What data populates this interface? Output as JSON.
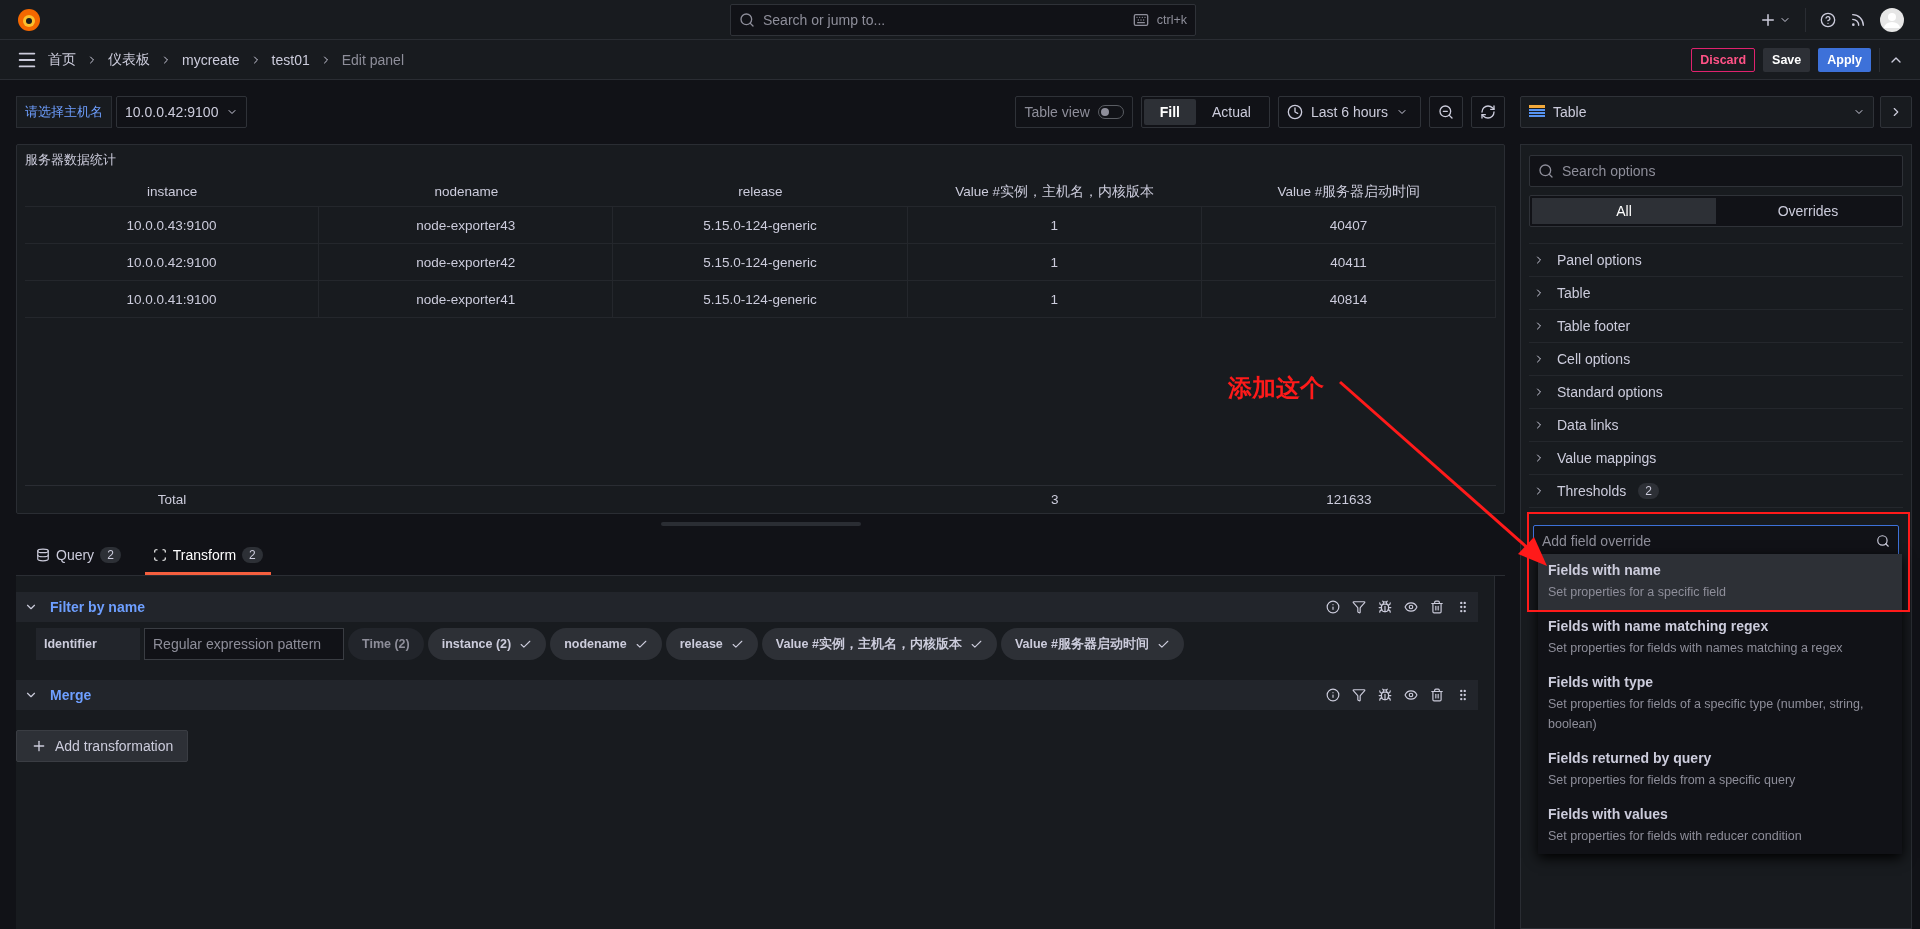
{
  "topbar": {
    "search_placeholder": "Search or jump to...",
    "shortcut": "ctrl+k"
  },
  "breadcrumbs": [
    {
      "label": "首页",
      "current": false
    },
    {
      "label": "仪表板",
      "current": false
    },
    {
      "label": "mycreate",
      "current": false
    },
    {
      "label": "test01",
      "current": false
    },
    {
      "label": "Edit panel",
      "current": true
    }
  ],
  "actions": [
    {
      "label": "Discard",
      "kind": "danger"
    },
    {
      "label": "Save",
      "kind": "secondary"
    },
    {
      "label": "Apply",
      "kind": "primary"
    }
  ],
  "variable": {
    "label": "请选择主机名",
    "value": "10.0.0.42:9100"
  },
  "toolbar": {
    "table_view": {
      "label": "Table view",
      "on": false
    },
    "size_modes": [
      {
        "label": "Fill",
        "selected": true
      },
      {
        "label": "Actual",
        "selected": false
      }
    ],
    "time_range": "Last 6 hours"
  },
  "panel": {
    "title": "服务器数据统计",
    "columns": [
      "instance",
      "nodename",
      "release",
      "Value #实例，主机名，内核版本",
      "Value #服务器启动时间"
    ],
    "rows": [
      [
        "10.0.0.43:9100",
        "node-exporter43",
        "5.15.0-124-generic",
        "1",
        "40407"
      ],
      [
        "10.0.0.42:9100",
        "node-exporter42",
        "5.15.0-124-generic",
        "1",
        "40411"
      ],
      [
        "10.0.0.41:9100",
        "node-exporter41",
        "5.15.0-124-generic",
        "1",
        "40814"
      ]
    ],
    "footer": {
      "label": "Total",
      "values": [
        "3",
        "121633"
      ]
    }
  },
  "tabs": [
    {
      "label": "Query",
      "count": "2",
      "selected": false
    },
    {
      "label": "Transform",
      "count": "2",
      "selected": true
    }
  ],
  "transformations": [
    {
      "title": "Filter by name",
      "identifier_label": "Identifier",
      "pattern_placeholder": "Regular expression pattern",
      "fields": [
        {
          "label": "Time (2)",
          "checked": false
        },
        {
          "label": "instance (2)",
          "checked": true
        },
        {
          "label": "nodename",
          "checked": true
        },
        {
          "label": "release",
          "checked": true
        },
        {
          "label": "Value #实例，主机名，内核版本",
          "checked": true
        },
        {
          "label": "Value #服务器启动时间",
          "checked": true
        }
      ]
    },
    {
      "title": "Merge"
    }
  ],
  "add_transformation": "Add transformation",
  "visualization": {
    "name": "Table"
  },
  "options": {
    "search_placeholder": "Search options",
    "tabs": [
      {
        "label": "All",
        "selected": true
      },
      {
        "label": "Overrides",
        "selected": false
      }
    ],
    "categories": [
      {
        "label": "Panel options"
      },
      {
        "label": "Table"
      },
      {
        "label": "Table footer"
      },
      {
        "label": "Cell options"
      },
      {
        "label": "Standard options"
      },
      {
        "label": "Data links"
      },
      {
        "label": "Value mappings"
      },
      {
        "label": "Thresholds",
        "count": "2"
      }
    ]
  },
  "override_picker": {
    "placeholder": "Add field override",
    "items": [
      {
        "title": "Fields with name",
        "description": "Set properties for a specific field",
        "selected": true
      },
      {
        "title": "Fields with name matching regex",
        "description": "Set properties for fields with names matching a regex",
        "selected": false
      },
      {
        "title": "Fields with type",
        "description": "Set properties for fields of a specific type (number, string, boolean)",
        "selected": false
      },
      {
        "title": "Fields returned by query",
        "description": "Set properties for fields from a specific query",
        "selected": false
      },
      {
        "title": "Fields with values",
        "description": "Set properties for fields with reducer condition",
        "selected": false
      }
    ]
  },
  "annotation": {
    "text": "添加这个"
  }
}
